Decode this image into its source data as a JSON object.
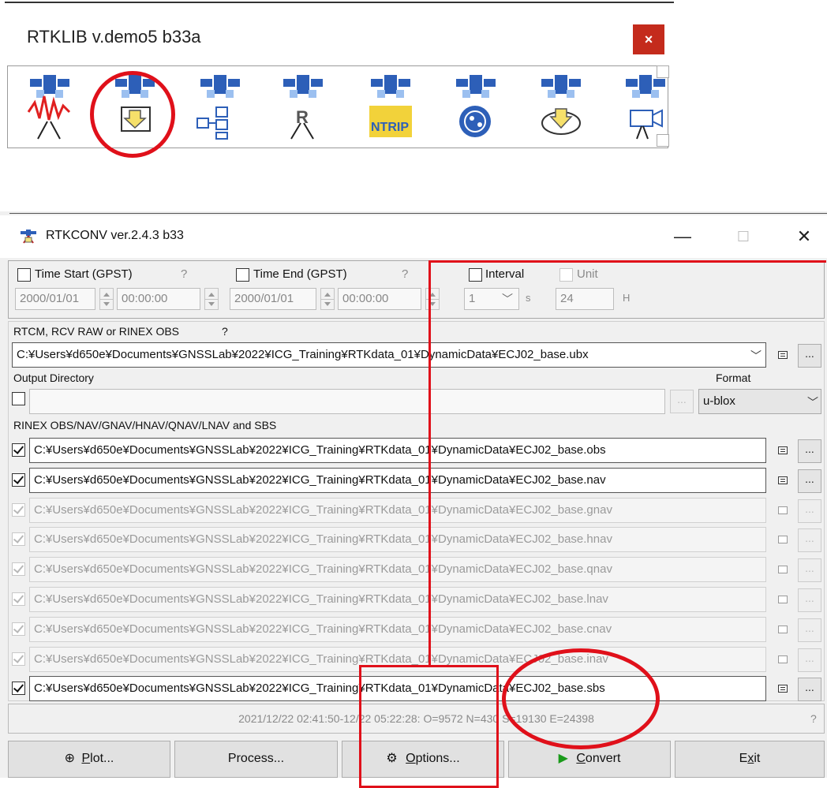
{
  "launcher": {
    "title": "RTKLIB v.demo5 b33a",
    "close_label": "×",
    "tools": [
      {
        "icon": "rtknavi-icon",
        "overlay": ""
      },
      {
        "icon": "rtkconv-icon",
        "overlay": ""
      },
      {
        "icon": "strsvr-icon",
        "overlay": ""
      },
      {
        "icon": "rtkpost-icon",
        "overlay": "R"
      },
      {
        "icon": "ntrip-browser-icon",
        "overlay": "NTRIP"
      },
      {
        "icon": "rtkplot-icon",
        "overlay": ""
      },
      {
        "icon": "rtkget-icon",
        "overlay": ""
      },
      {
        "icon": "rtkvideo-icon",
        "overlay": ""
      }
    ]
  },
  "rtkconv": {
    "title": "RTKCONV ver.2.4.3 b33",
    "minimize_label": "—",
    "maximize_label": "☐",
    "close_label": "✕",
    "time_start": {
      "label": "Time Start (GPST)",
      "help": "?",
      "date": "2000/01/01",
      "time": "00:00:00",
      "checked": false
    },
    "time_end": {
      "label": "Time End (GPST)",
      "help": "?",
      "date": "2000/01/01",
      "time": "00:00:00",
      "checked": false
    },
    "interval": {
      "label": "Interval",
      "value": "1",
      "unit_suffix": "s",
      "checked": false
    },
    "unit": {
      "label": "Unit",
      "value": "24",
      "suffix": "H",
      "checked": false
    },
    "input": {
      "label": "RTCM, RCV RAW or RINEX OBS",
      "help": "?",
      "path": "C:¥Users¥d650e¥Documents¥GNSSLab¥2022¥ICG_Training¥RTKdata_01¥DynamicData¥ECJ02_base.ubx"
    },
    "output_dir": {
      "label": "Output Directory",
      "path": "",
      "checked": false
    },
    "format": {
      "label": "Format",
      "value": "u-blox"
    },
    "outputs_label": "RINEX OBS/NAV/GNAV/HNAV/QNAV/LNAV and SBS",
    "outputs": [
      {
        "path": "C:¥Users¥d650e¥Documents¥GNSSLab¥2022¥ICG_Training¥RTKdata_01¥DynamicData¥ECJ02_base.obs",
        "checked": true,
        "enabled": true
      },
      {
        "path": "C:¥Users¥d650e¥Documents¥GNSSLab¥2022¥ICG_Training¥RTKdata_01¥DynamicData¥ECJ02_base.nav",
        "checked": true,
        "enabled": true
      },
      {
        "path": "C:¥Users¥d650e¥Documents¥GNSSLab¥2022¥ICG_Training¥RTKdata_01¥DynamicData¥ECJ02_base.gnav",
        "checked": true,
        "enabled": false
      },
      {
        "path": "C:¥Users¥d650e¥Documents¥GNSSLab¥2022¥ICG_Training¥RTKdata_01¥DynamicData¥ECJ02_base.hnav",
        "checked": true,
        "enabled": false
      },
      {
        "path": "C:¥Users¥d650e¥Documents¥GNSSLab¥2022¥ICG_Training¥RTKdata_01¥DynamicData¥ECJ02_base.qnav",
        "checked": true,
        "enabled": false
      },
      {
        "path": "C:¥Users¥d650e¥Documents¥GNSSLab¥2022¥ICG_Training¥RTKdata_01¥DynamicData¥ECJ02_base.lnav",
        "checked": true,
        "enabled": false
      },
      {
        "path": "C:¥Users¥d650e¥Documents¥GNSSLab¥2022¥ICG_Training¥RTKdata_01¥DynamicData¥ECJ02_base.cnav",
        "checked": true,
        "enabled": false
      },
      {
        "path": "C:¥Users¥d650e¥Documents¥GNSSLab¥2022¥ICG_Training¥RTKdata_01¥DynamicData¥ECJ02_base.inav",
        "checked": true,
        "enabled": false
      },
      {
        "path": "C:¥Users¥d650e¥Documents¥GNSSLab¥2022¥ICG_Training¥RTKdata_01¥DynamicData¥ECJ02_base.sbs",
        "checked": true,
        "enabled": true
      }
    ],
    "status_text": "2021/12/22 02:41:50-12/22 05:22:28: O=9572 N=430 S=19130 E=24398",
    "status_help": "?",
    "buttons": {
      "plot": {
        "icon": "⊕",
        "prefix": "",
        "underline": "P",
        "rest": "lot..."
      },
      "process": {
        "label": "Process..."
      },
      "options": {
        "icon": "⚙",
        "underline": "O",
        "rest": "ptions..."
      },
      "convert": {
        "icon": "▶",
        "underline": "C",
        "rest": "onvert"
      },
      "exit": {
        "prefix": "E",
        "underline": "x",
        "rest": "it"
      }
    },
    "colors": {
      "accent_green": "#1a9a1a",
      "highlight_red": "#e0101a"
    }
  }
}
